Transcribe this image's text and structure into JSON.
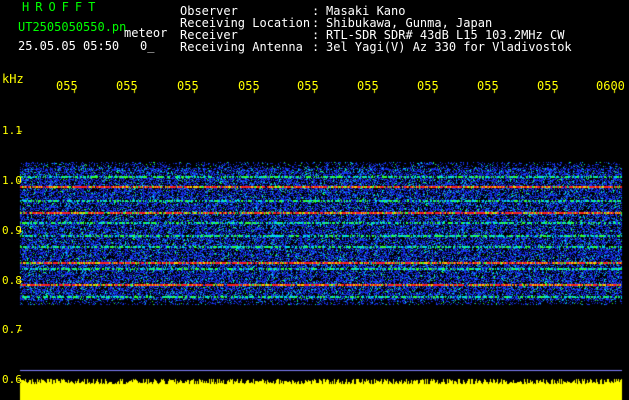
{
  "header": {
    "app_title": "HROFFT",
    "filename": "UT2505050550.pn",
    "mode": "meteor",
    "datetime": "25.05.05 05:50",
    "count": "0_"
  },
  "station_info": [
    {
      "label": "Observer",
      "value": "Masaki Kano"
    },
    {
      "label": "Receiving Location",
      "value": "Shibukawa, Gunma, Japan"
    },
    {
      "label": "Receiver",
      "value": "RTL-SDR SDR# 43dB L15 103.2MHz CW"
    },
    {
      "label": "Receiving Antenna",
      "value": "3el Yagi(V) Az 330 for Vladivostok"
    }
  ],
  "axes": {
    "unit_label": "kHz",
    "time_ticks": [
      "055",
      "055",
      "055",
      "055",
      "055",
      "055",
      "055",
      "055",
      "055",
      "0600"
    ],
    "freq_ticks": [
      "1.1",
      "1.0",
      "0.9",
      "0.8",
      "0.7",
      "0.6"
    ]
  },
  "colors": {
    "background": "#000000",
    "header_green": "#00ff00",
    "header_white": "#ffffff",
    "axis_yellow": "#ffff00",
    "noise_blue": "#1a3cff",
    "signal_cyan": "#00e0e0",
    "signal_green": "#30ff30",
    "signal_red": "#ff2020"
  }
}
